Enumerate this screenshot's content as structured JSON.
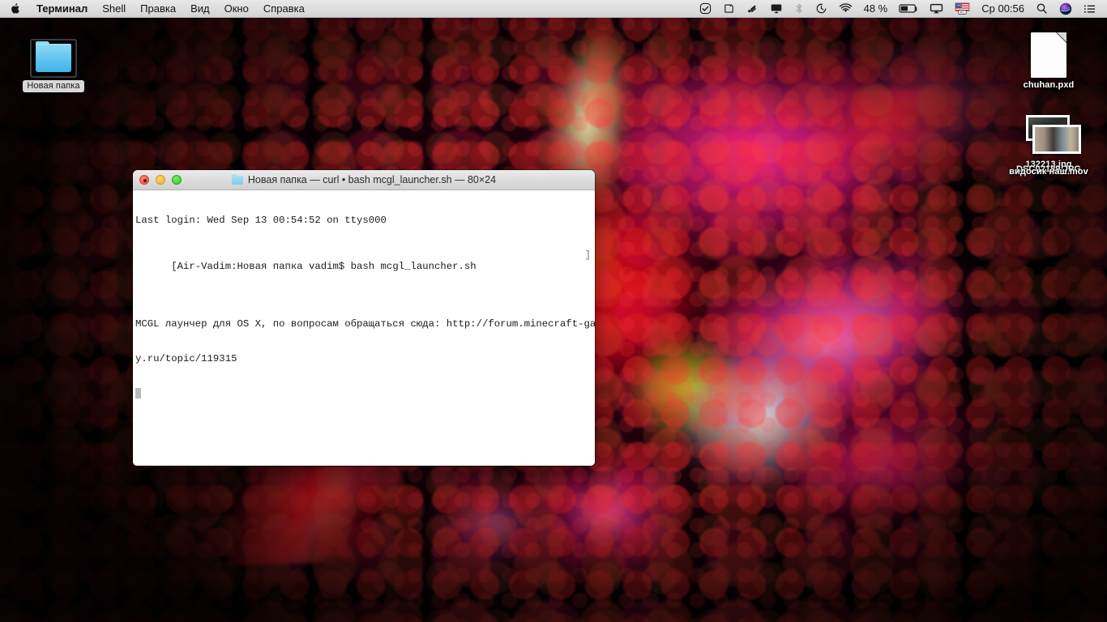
{
  "menubar": {
    "apple_icon": "apple-logo-icon",
    "app_name": "Терминал",
    "items": [
      "Shell",
      "Правка",
      "Вид",
      "Окно",
      "Справка"
    ],
    "status_icons": [
      "checkmark-circle-icon",
      "hard-disk-icon",
      "dropbox-icon",
      "airplay-display-icon",
      "bluetooth-icon",
      "time-machine-icon",
      "wifi-icon"
    ],
    "battery_percent": "48 %",
    "battery_icon": "battery-icon",
    "airplay_icon": "airplay-icon",
    "input_source_icon": "us-flag-pc-icon",
    "clock": "Ср 00:56",
    "spotlight_icon": "search-icon",
    "siri_icon": "siri-icon",
    "notification_center_icon": "list-lines-icon"
  },
  "desktop": {
    "icons": [
      {
        "name": "Новая папка",
        "kind": "folder-icon",
        "selected": true
      },
      {
        "name": "chuhan.pxd",
        "kind": "document-icon",
        "selected": false
      }
    ],
    "photo_stack": {
      "kind": "photo-stack-icon",
      "labels": [
        "132213.jpg",
        "DSC02189.JPG",
        "видосик наш.mov"
      ]
    }
  },
  "terminal": {
    "title": "Новая папка — curl • bash mcgl_launcher.sh — 80×24",
    "title_folder_icon": "folder-icon",
    "traffic_lights": {
      "close": "close-button",
      "minimize": "minimize-button",
      "zoom": "zoom-button"
    },
    "lines": [
      "Last login: Wed Sep 13 00:54:52 on ttys000",
      "[Air-Vadim:Новая папка vadim$ bash mcgl_launcher.sh",
      "MCGL лаунчер для OS X, по вопросам обращаться сюда: http://forum.minecraft-galax",
      "y.ru/topic/119315"
    ],
    "line_bracket_right": "]",
    "columns": "80",
    "rows": "24"
  },
  "colors": {
    "menubar_bg": "#dedede",
    "terminal_bg": "#ffffff",
    "terminal_fg": "#1b1b1b",
    "close_red": "#f4523f",
    "min_yellow": "#f0b429",
    "max_green": "#35c82b",
    "folder_blue": "#5cc4ef",
    "wallpaper_black": "#000000",
    "wallpaper_magenta": "#ff2896",
    "wallpaper_red": "#ff141e"
  }
}
